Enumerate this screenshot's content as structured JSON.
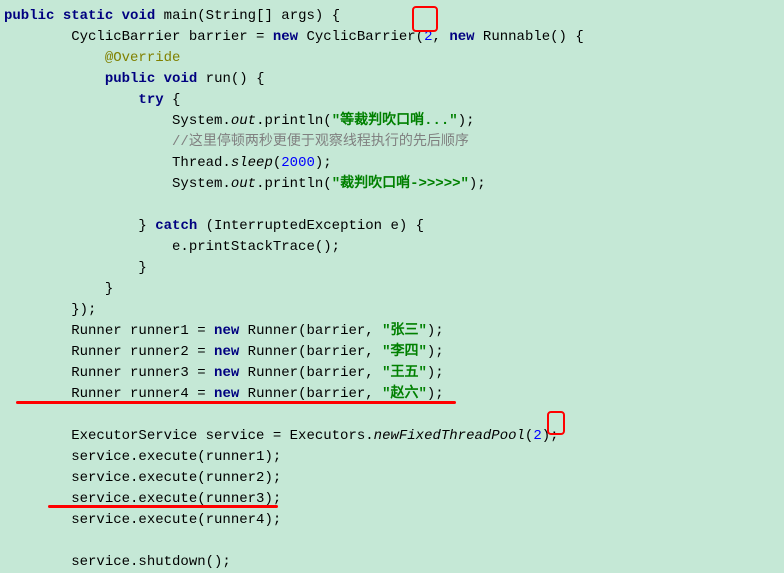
{
  "code": {
    "l1a": "public",
    "l1b": " ",
    "l1c": "static",
    "l1d": " ",
    "l1e": "void",
    "l1f": " main(String[] args) ",
    "l1g": "{",
    "l2a": "        CyclicBarrier barrier = ",
    "l2b": "new",
    "l2c": " CyclicBarrier(",
    "l2d": "2",
    "l2e": ", ",
    "l2f": "new",
    "l2g": " Runnable() {",
    "l3a": "            ",
    "l3b": "@Override",
    "l4a": "            ",
    "l4b": "public",
    "l4c": " ",
    "l4d": "void",
    "l4e": " run() {",
    "l5a": "                ",
    "l5b": "try",
    "l5c": " {",
    "l6a": "                    System.",
    "l6b": "out",
    "l6c": ".println(",
    "l6d": "\"等裁判吹口哨...\"",
    "l6e": ");",
    "l7a": "                    ",
    "l7b": "//这里停顿两秒更便于观察线程执行的先后顺序",
    "l8a": "                    Thread.",
    "l8b": "sleep",
    "l8c": "(",
    "l8d": "2000",
    "l8e": ");",
    "l9a": "                    System.",
    "l9b": "out",
    "l9c": ".println(",
    "l9d": "\"裁判吹口哨->>>>>\"",
    "l9e": ");",
    "l10": "",
    "l11a": "                } ",
    "l11b": "catch",
    "l11c": " (InterruptedException e) {",
    "l12": "                    e.printStackTrace();",
    "l13": "                }",
    "l14": "            }",
    "l15": "        });",
    "l16a": "        Runner runner1 = ",
    "l16b": "new",
    "l16c": " Runner(barrier, ",
    "l16d": "\"张三\"",
    "l16e": ");",
    "l17a": "        Runner runner2 = ",
    "l17b": "new",
    "l17c": " Runner(barrier, ",
    "l17d": "\"李四\"",
    "l17e": ");",
    "l18a": "        Runner runner3 = ",
    "l18b": "new",
    "l18c": " Runner(barrier, ",
    "l18d": "\"王五\"",
    "l18e": ");",
    "l19a": "        Runner runner4 = ",
    "l19b": "new",
    "l19c": " Runner(barrier, ",
    "l19d": "\"赵六\"",
    "l19e": ");",
    "l20": "",
    "l21a": "        ExecutorService service = Executors.",
    "l21b": "newFixedThreadPool",
    "l21c": "(",
    "l21d": "2",
    "l21e": ");",
    "l22": "        service.execute(runner1);",
    "l23": "        service.execute(runner2);",
    "l24": "        service.execute(runner3);",
    "l25": "        service.execute(runner4);",
    "l26": "",
    "l27": "        service.shutdown();"
  }
}
